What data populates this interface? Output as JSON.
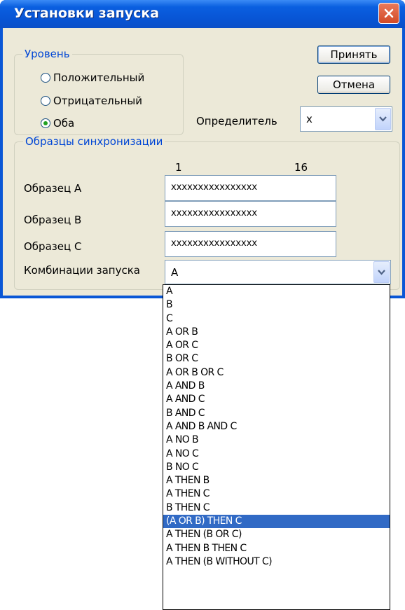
{
  "dialog": {
    "title": "Установки запуска"
  },
  "level_group": {
    "legend": "Уровень",
    "options": [
      {
        "label": "Положительный",
        "checked": false
      },
      {
        "label": "Отрицательный",
        "checked": false
      },
      {
        "label": "Оба",
        "checked": true
      }
    ]
  },
  "buttons": {
    "accept": "Принять",
    "cancel": "Отмена"
  },
  "qualifier": {
    "label": "Определитель",
    "value": "x"
  },
  "sync_group": {
    "legend": "Образцы синхронизации",
    "bit_start": "1",
    "bit_end": "16",
    "patterns": [
      {
        "label": "Образец A",
        "value": "xxxxxxxxxxxxxxxx"
      },
      {
        "label": "Образец B",
        "value": "xxxxxxxxxxxxxxxx"
      },
      {
        "label": "Образец C",
        "value": "xxxxxxxxxxxxxxxx"
      }
    ],
    "combo_label": "Комбинации запуска",
    "combo_value": "A"
  },
  "dropdown": {
    "selected_index": 17,
    "items": [
      "A",
      "B",
      "C",
      "A OR B",
      "A OR C",
      "B OR C",
      "A OR B OR C",
      "A AND B",
      "A AND C",
      "B AND C",
      "A AND B AND C",
      "A NO B",
      "A NO C",
      "B NO C",
      "A THEN B",
      "A THEN C",
      "B THEN C",
      "(A OR B) THEN C",
      "A THEN (B OR C)",
      "A THEN B THEN C",
      "A THEN (B WITHOUT C)"
    ]
  },
  "colors": {
    "titlebar": "#0a57d6",
    "legend_text": "#0046d5",
    "selection": "#316ac5",
    "dialog_bg": "#ece9d8"
  }
}
